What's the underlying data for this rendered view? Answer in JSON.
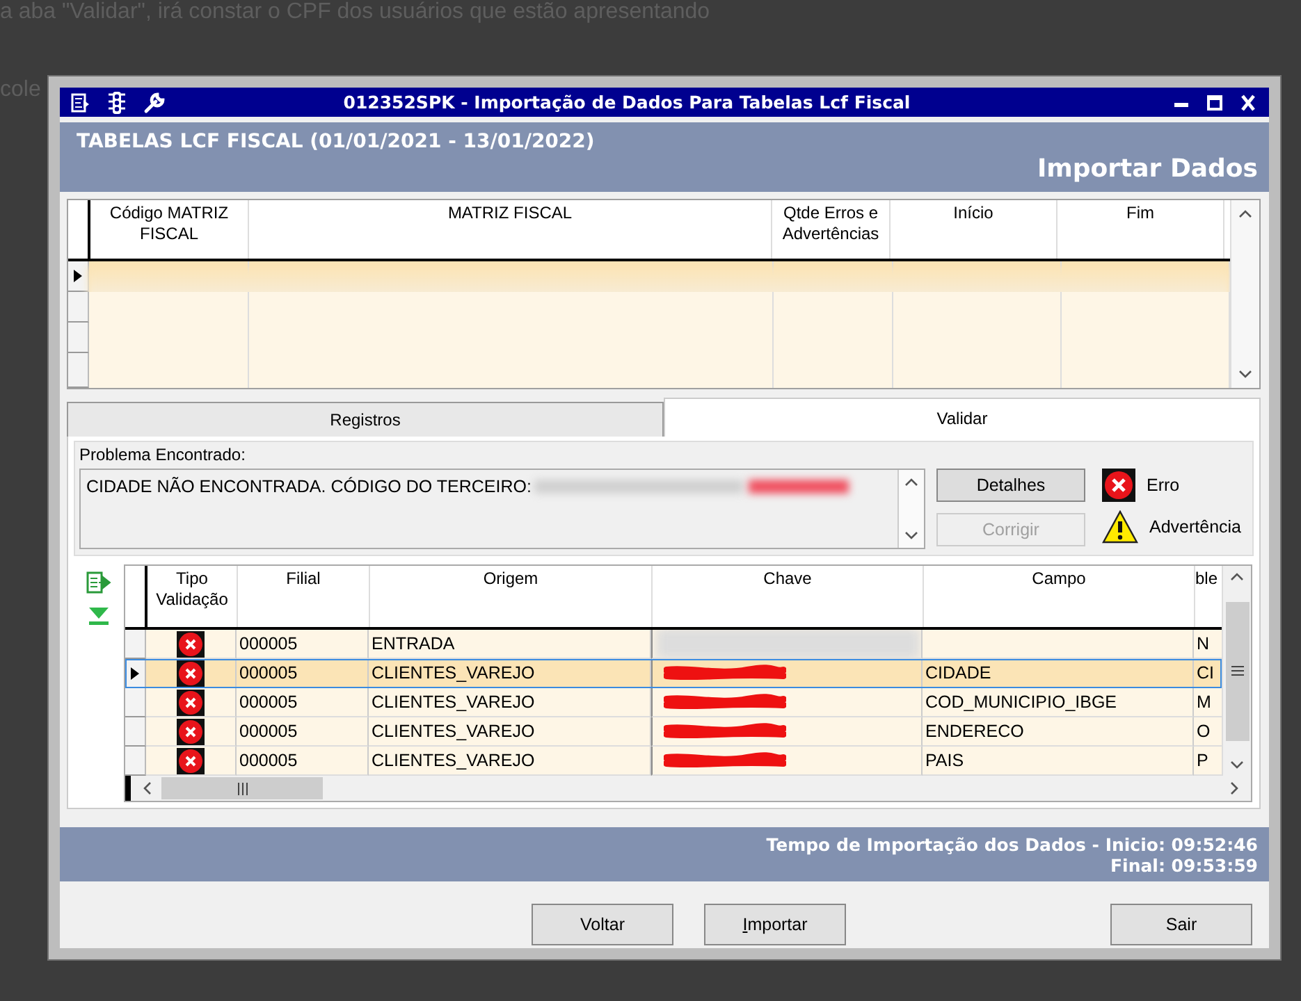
{
  "background_text": [
    {
      "text": "a aba \"Validar\", irá constar o CPF dos usuários que estão apresentando"
    },
    {
      "text": "cole"
    }
  ],
  "window": {
    "title": "012352SPK - Importação de Dados Para Tabelas Lcf Fiscal"
  },
  "header": {
    "title": "TABELAS LCF FISCAL (01/01/2021 - 13/01/2022)",
    "subtitle": "Importar Dados"
  },
  "matrix_table": {
    "columns": [
      "Código MATRIZ FISCAL",
      "MATRIZ FISCAL",
      "Qtde Erros e Advertências",
      "Início",
      "Fim"
    ],
    "rows": [
      {
        "selected": true
      }
    ]
  },
  "tabs": [
    {
      "label": "Registros",
      "selected": false
    },
    {
      "label": "Validar",
      "selected": true
    }
  ],
  "problem": {
    "label": "Problema Encontrado:",
    "text": "CIDADE NÃO ENCONTRADA. CÓDIGO DO TERCEIRO:"
  },
  "side_buttons": [
    {
      "label": "Detalhes",
      "disabled": false
    },
    {
      "label": "Corrigir",
      "disabled": true
    }
  ],
  "legend": [
    {
      "kind": "error",
      "label": "Erro"
    },
    {
      "kind": "warning",
      "label": "Advertência"
    }
  ],
  "validation_table": {
    "columns": [
      "Tipo Validação",
      "Filial",
      "Origem",
      "Chave",
      "Campo",
      "ble"
    ],
    "rows": [
      {
        "kind": "error",
        "selected": false,
        "filial": "000005",
        "origem": "ENTRADA",
        "chave": {
          "kind": "blur"
        },
        "column_6": "N"
      },
      {
        "kind": "error",
        "selected": true,
        "filial": "000005",
        "origem": "CLIENTES_VAREJO",
        "chave": {
          "kind": "scribble"
        },
        "campo": "CIDADE",
        "column_6": "CI"
      },
      {
        "kind": "error",
        "selected": false,
        "filial": "000005",
        "origem": "CLIENTES_VAREJO",
        "chave": {
          "kind": "scribble"
        },
        "campo": "COD_MUNICIPIO_IBGE",
        "column_6": "M"
      },
      {
        "kind": "error",
        "selected": false,
        "filial": "000005",
        "origem": "CLIENTES_VAREJO",
        "chave": {
          "kind": "scribble"
        },
        "campo": "ENDERECO",
        "column_6": "O"
      },
      {
        "kind": "error",
        "selected": false,
        "filial": "000005",
        "origem": "CLIENTES_VAREJO",
        "chave": {
          "kind": "scribble"
        },
        "campo": "PAIS",
        "column_6": "P"
      }
    ]
  },
  "status": {
    "lines": [
      "Tempo de Importação dos Dados - Inicio: 09:52:46",
      "Final: 09:53:59"
    ]
  },
  "footer_buttons": [
    {
      "label": "Voltar",
      "underline_first": false
    },
    {
      "label": "Importar",
      "underline_first": true
    },
    {
      "label": "Sair",
      "underline_first": false
    }
  ]
}
